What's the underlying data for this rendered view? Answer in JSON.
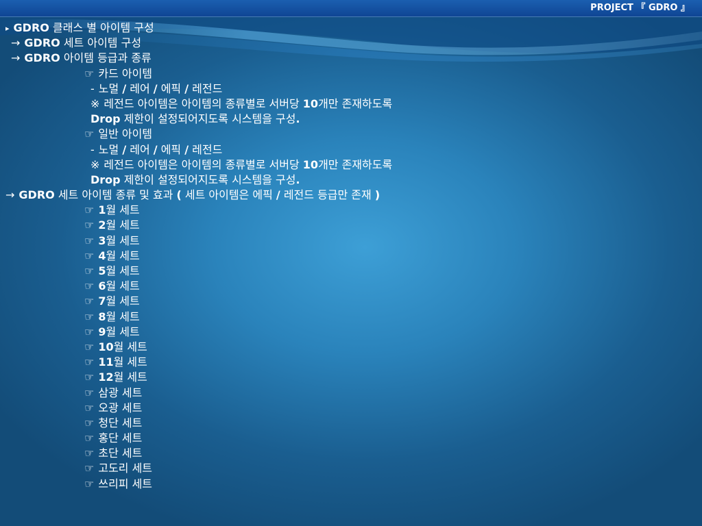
{
  "header": {
    "title": "PROJECT 『 GDRO 』"
  },
  "lines": [
    {
      "marker": "▸",
      "text": "GDRO 클래스 별 아이템 구성",
      "indent": 0
    },
    {
      "marker": "→",
      "text": "GDRO 세트 아이템 구성",
      "indent": 1
    },
    {
      "marker": "→",
      "text": "GDRO 아이템 등급과 종류",
      "indent": 1
    },
    {
      "marker": "☞",
      "text": "카드 아이템",
      "indent": 2
    },
    {
      "marker": "-",
      "text": "노멀 / 레어 / 에픽 / 레전드",
      "indent": 3
    },
    {
      "marker": "※",
      "text": "레전드 아이템은 아이템의 종류별로 서버당 10개만 존재하도록",
      "indent": 3
    },
    {
      "marker": "",
      "text": "Drop 제한이 설정되어지도록 시스템을 구성.",
      "indent": 3
    },
    {
      "marker": "☞",
      "text": "일반 아이템",
      "indent": 2
    },
    {
      "marker": "-",
      "text": "노멀 / 레어 / 에픽 / 레전드",
      "indent": 3
    },
    {
      "marker": "※",
      "text": "레전드 아이템은 아이템의 종류별로 서버당 10개만 존재하도록",
      "indent": 3
    },
    {
      "marker": "",
      "text": "Drop 제한이 설정되어지도록 시스템을 구성.",
      "indent": 3
    },
    {
      "marker": "→",
      "text": "GDRO 세트 아이템 종류 및 효과 ( 세트 아이템은 에픽 / 레전드 등급만 존재 )",
      "indent": 0
    },
    {
      "marker": "☞",
      "text": "1월 세트",
      "indent": 2
    },
    {
      "marker": "☞",
      "text": "2월 세트",
      "indent": 2
    },
    {
      "marker": "☞",
      "text": "3월 세트",
      "indent": 2
    },
    {
      "marker": "☞",
      "text": "4월 세트",
      "indent": 2
    },
    {
      "marker": "☞",
      "text": "5월 세트",
      "indent": 2
    },
    {
      "marker": "☞",
      "text": "6월 세트",
      "indent": 2
    },
    {
      "marker": "☞",
      "text": "7월 세트",
      "indent": 2
    },
    {
      "marker": "☞",
      "text": "8월 세트",
      "indent": 2
    },
    {
      "marker": "☞",
      "text": "9월 세트",
      "indent": 2
    },
    {
      "marker": "☞",
      "text": "10월 세트",
      "indent": 2
    },
    {
      "marker": "☞",
      "text": "11월 세트",
      "indent": 2
    },
    {
      "marker": "☞",
      "text": "12월 세트",
      "indent": 2
    },
    {
      "marker": "☞",
      "text": "삼광 세트",
      "indent": 2
    },
    {
      "marker": "☞",
      "text": "오광 세트",
      "indent": 2
    },
    {
      "marker": "☞",
      "text": "청단 세트",
      "indent": 2
    },
    {
      "marker": "☞",
      "text": "홍단 세트",
      "indent": 2
    },
    {
      "marker": "☞",
      "text": "초단 세트",
      "indent": 2
    },
    {
      "marker": "☞",
      "text": "고도리 세트",
      "indent": 2
    },
    {
      "marker": "☞",
      "text": "쓰리피 세트",
      "indent": 2
    }
  ],
  "colors": {
    "text": "#ffffff",
    "top_bar": "#1b5fb0",
    "background_center": "#3d9fd6",
    "background_edge": "#134c78"
  }
}
